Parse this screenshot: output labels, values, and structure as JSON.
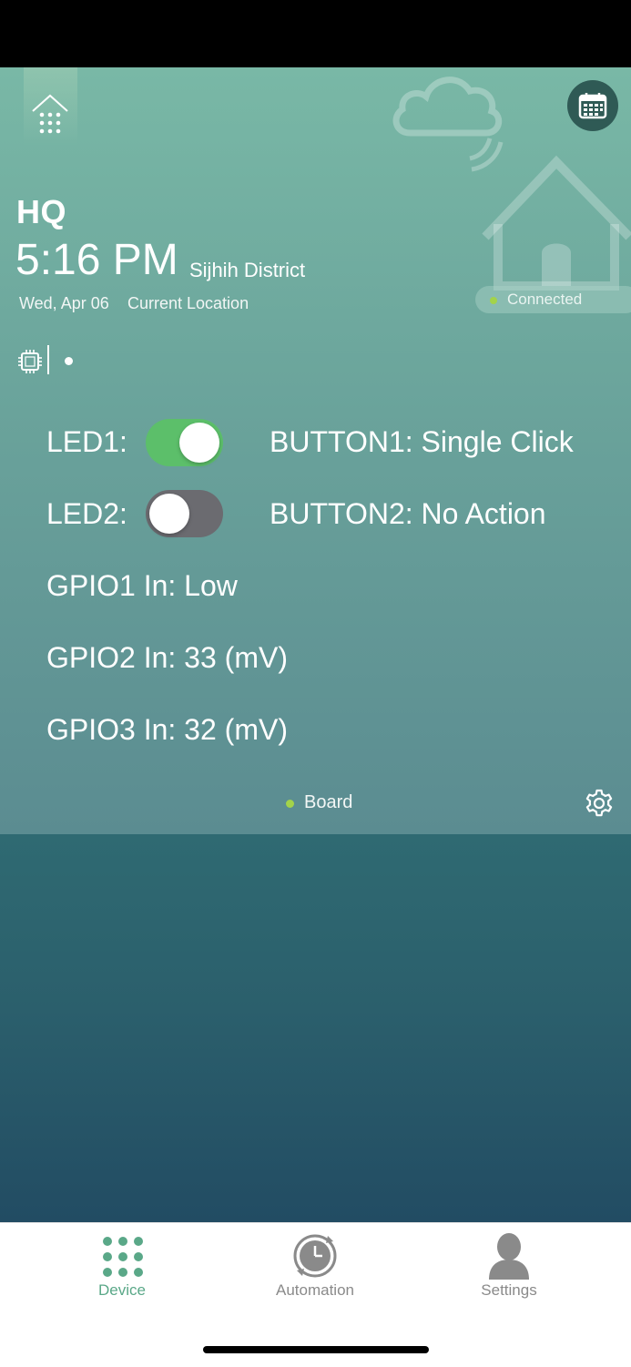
{
  "header": {
    "location_name": "HQ",
    "time": "5:16 PM",
    "district": "Sijhih District",
    "date": "Wed, Apr 06",
    "current_location": "Current Location",
    "connection_status": "Connected"
  },
  "device": {
    "led1_label": "LED1:",
    "led1_on": true,
    "led2_label": "LED2:",
    "led2_on": false,
    "button1": "BUTTON1: Single Click",
    "button2": "BUTTON2: No Action",
    "gpio1": "GPIO1 In: Low",
    "gpio2": "GPIO2 In: 33 (mV)",
    "gpio3": "GPIO3 In: 32 (mV)",
    "board_label": "Board"
  },
  "tabs": [
    {
      "label": "Device",
      "icon": "grid-dots-icon",
      "active": true
    },
    {
      "label": "Automation",
      "icon": "clock-icon",
      "active": false
    },
    {
      "label": "Settings",
      "icon": "person-icon",
      "active": false
    }
  ],
  "colors": {
    "accent_green": "#5cbf6a",
    "status_dot": "#a3d34a",
    "toggle_off": "#6b6b70",
    "tab_active": "#5aa888",
    "tab_inactive": "#8a8a8a"
  }
}
